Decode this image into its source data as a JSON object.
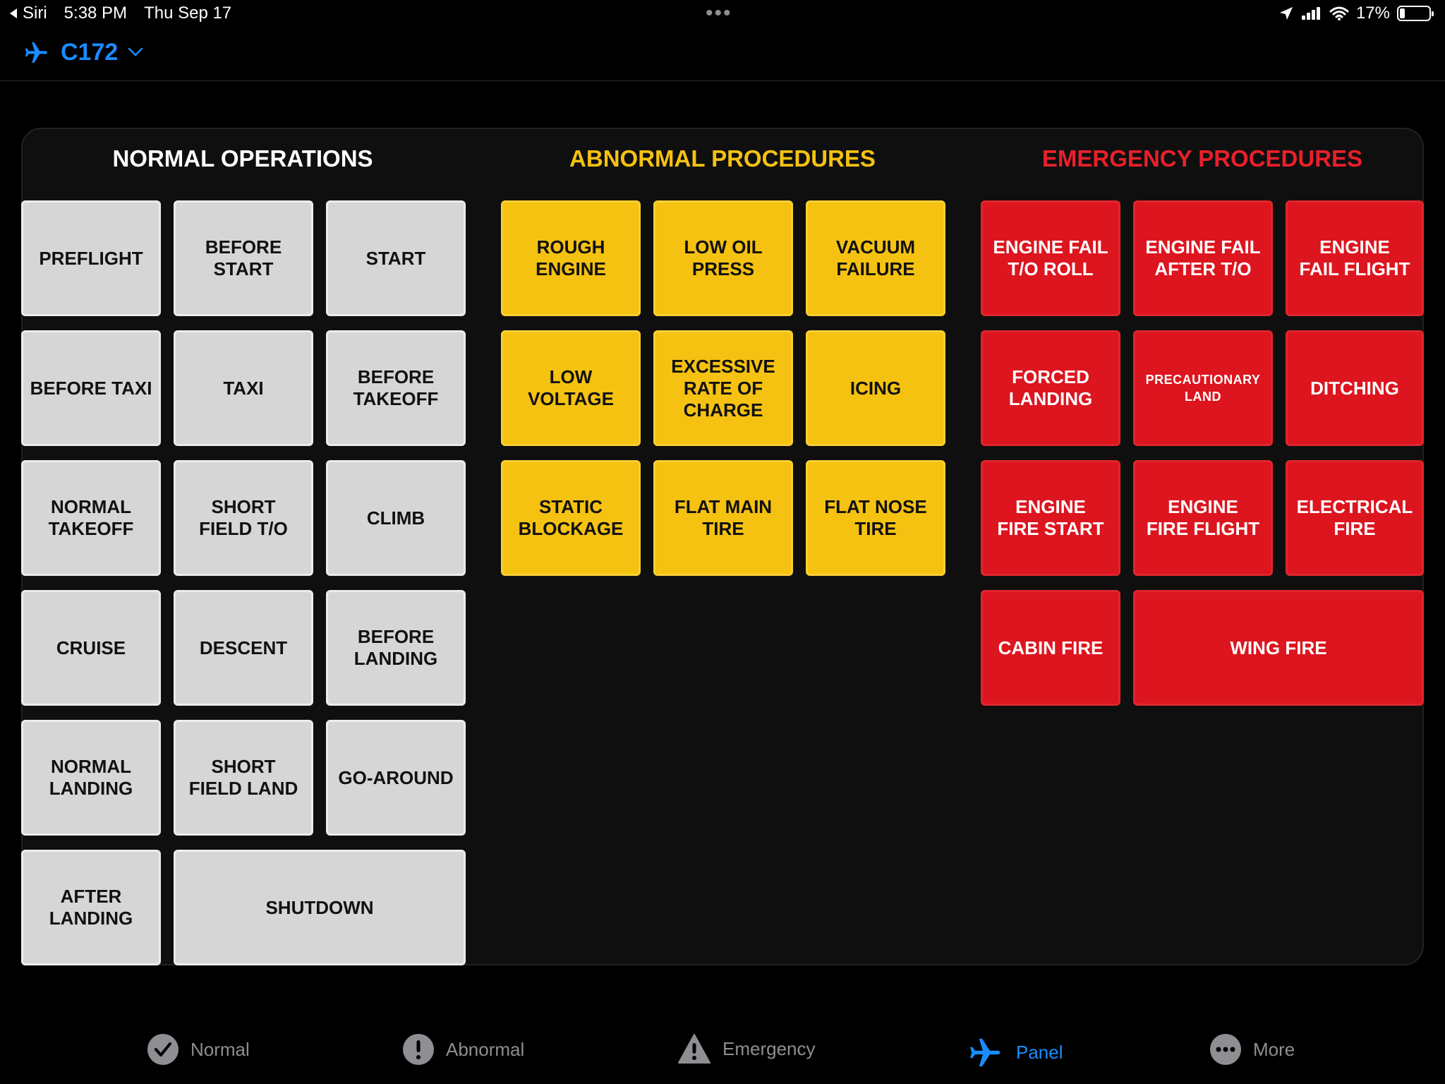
{
  "status": {
    "back_label": "Siri",
    "time": "5:38 PM",
    "date": "Thu Sep 17",
    "battery": "17%",
    "battery_level": 0.17
  },
  "header": {
    "aircraft": "C172"
  },
  "sections": [
    {
      "title": "NORMAL OPERATIONS",
      "color": "#ffffff"
    },
    {
      "title": "ABNORMAL PROCEDURES",
      "color": "#f5c211"
    },
    {
      "title": "EMERGENCY PROCEDURES",
      "color": "#e8202a"
    }
  ],
  "normal": {
    "preflight": "PREFLIGHT",
    "before_start": "BEFORE\nSTART",
    "start": "START",
    "before_taxi": "BEFORE TAXI",
    "taxi": "TAXI",
    "before_takeoff": "BEFORE\nTAKEOFF",
    "normal_takeoff": "NORMAL\nTAKEOFF",
    "short_field_to": "SHORT\nFIELD T/O",
    "climb": "CLIMB",
    "cruise": "CRUISE",
    "descent": "DESCENT",
    "before_landing": "BEFORE\nLANDING",
    "normal_landing": "NORMAL\nLANDING",
    "short_field_land": "SHORT\nFIELD LAND",
    "go_around": "GO-AROUND",
    "after_landing": "AFTER\nLANDING",
    "shutdown": "SHUTDOWN"
  },
  "abnormal": {
    "rough_engine": "ROUGH\nENGINE",
    "low_oil_press": "LOW OIL\nPRESS",
    "vacuum_failure": "VACUUM\nFAILURE",
    "low_voltage": "LOW\nVOLTAGE",
    "excessive_rate_of_charge": "EXCESSIVE\nRATE OF\nCHARGE",
    "icing": "ICING",
    "static_blockage": "STATIC\nBLOCKAGE",
    "flat_main_tire": "FLAT MAIN\nTIRE",
    "flat_nose_tire": "FLAT NOSE\nTIRE"
  },
  "emergency": {
    "engine_fail_to_roll": "ENGINE FAIL\nT/O ROLL",
    "engine_fail_after_to": "ENGINE FAIL\nAFTER T/O",
    "engine_fail_flight": "ENGINE\nFAIL FLIGHT",
    "forced_landing": "FORCED\nLANDING",
    "precautionary_land": "PRECAUTIONARY\nLAND",
    "ditching": "DITCHING",
    "engine_fire_start": "ENGINE\nFIRE START",
    "engine_fire_flight": "ENGINE\nFIRE FLIGHT",
    "electrical_fire": "ELECTRICAL\nFIRE",
    "cabin_fire": "CABIN FIRE",
    "wing_fire": "WING FIRE"
  },
  "tabs": [
    {
      "label": "Normal",
      "icon": "checkmark-circle-icon"
    },
    {
      "label": "Abnormal",
      "icon": "exclamation-circle-icon"
    },
    {
      "label": "Emergency",
      "icon": "warning-triangle-icon"
    },
    {
      "label": "Panel",
      "icon": "airplane-icon",
      "active": true
    },
    {
      "label": "More",
      "icon": "ellipsis-circle-icon"
    }
  ],
  "colors": {
    "accent": "#1a8cff",
    "normal_tile": "#d6d6d6",
    "abnormal_tile": "#f5c211",
    "emergency_tile": "#dd151f"
  }
}
